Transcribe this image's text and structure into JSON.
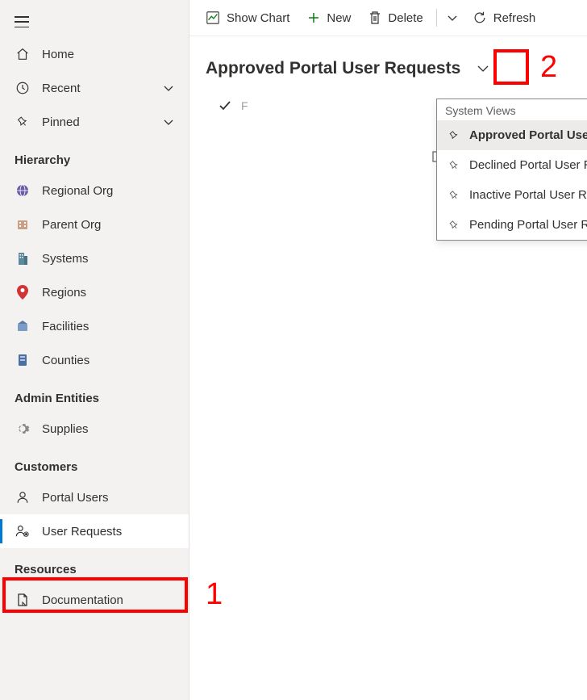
{
  "nav": {
    "home": "Home",
    "recent": "Recent",
    "pinned": "Pinned"
  },
  "sections": {
    "hierarchy": {
      "title": "Hierarchy",
      "items": [
        "Regional Org",
        "Parent Org",
        "Systems",
        "Regions",
        "Facilities",
        "Counties"
      ]
    },
    "admin": {
      "title": "Admin Entities",
      "items": [
        "Supplies"
      ]
    },
    "customers": {
      "title": "Customers",
      "items": [
        "Portal Users",
        "User Requests"
      ]
    },
    "resources": {
      "title": "Resources",
      "items": [
        "Documentation"
      ]
    }
  },
  "commandBar": {
    "showChart": "Show Chart",
    "new": "New",
    "delete": "Delete",
    "refresh": "Refresh"
  },
  "view": {
    "title": "Approved Portal User Requests"
  },
  "dropdown": {
    "header": "System Views",
    "items": [
      "Approved Portal User Requests",
      "Declined Portal User Requests",
      "Inactive Portal User Requests",
      "Pending Portal User Requests"
    ]
  },
  "annotations": {
    "label1": "1",
    "label2": "2"
  }
}
